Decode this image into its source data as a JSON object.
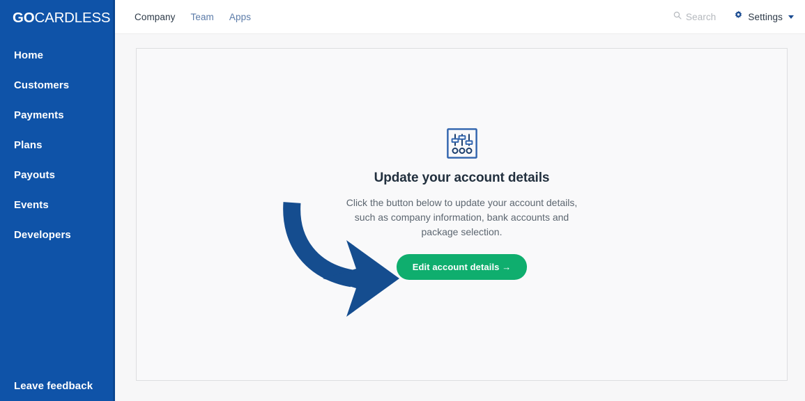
{
  "brand": {
    "logo_primary": "GO",
    "logo_secondary": "CARDLESS",
    "sidebar_color": "#0f53a8",
    "accent_green": "#0fae6e",
    "arrow_color": "#154d8f"
  },
  "sidebar": {
    "items": [
      {
        "label": "Home",
        "name": "sidebar-item-home"
      },
      {
        "label": "Customers",
        "name": "sidebar-item-customers"
      },
      {
        "label": "Payments",
        "name": "sidebar-item-payments"
      },
      {
        "label": "Plans",
        "name": "sidebar-item-plans"
      },
      {
        "label": "Payouts",
        "name": "sidebar-item-payouts"
      },
      {
        "label": "Events",
        "name": "sidebar-item-events"
      },
      {
        "label": "Developers",
        "name": "sidebar-item-developers"
      }
    ],
    "footer_link": "Leave feedback"
  },
  "topbar": {
    "tabs": [
      {
        "label": "Company",
        "active": true
      },
      {
        "label": "Team",
        "active": false
      },
      {
        "label": "Apps",
        "active": false
      }
    ],
    "search": {
      "label": "Search",
      "placeholder": "Search",
      "icon": "search-icon"
    },
    "settings": {
      "label": "Settings",
      "icon": "gear-icon",
      "caret": "chevron-down-icon"
    }
  },
  "main": {
    "empty_state": {
      "icon": "sliders-settings-icon",
      "title": "Update your account details",
      "description": "Click the button below to update your account details, such as company information, bank accounts and package selection.",
      "cta_label": "Edit account details →"
    },
    "annotation": {
      "type": "curved-arrow",
      "points_to": "edit-account-details-button"
    }
  }
}
